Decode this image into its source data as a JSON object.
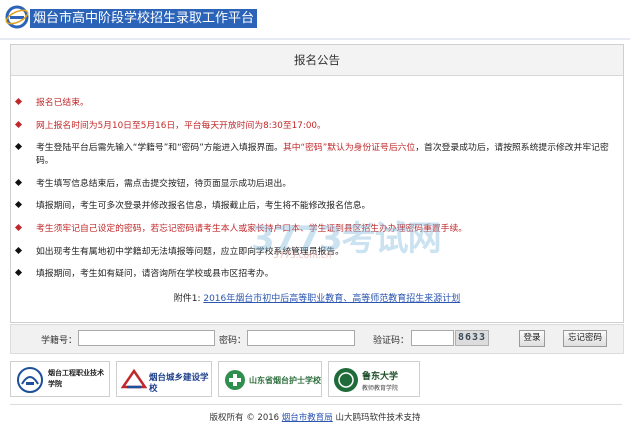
{
  "header": {
    "site_title": "烟台市高中阶段学校招生录取工作平台"
  },
  "panel": {
    "heading": "报名公告"
  },
  "notices": [
    {
      "color": "red",
      "text": "报名已结束。"
    },
    {
      "color": "red",
      "text": "网上报名时间为5月10日至5月16日，平台每天开放时间为8:30至17:00。"
    },
    {
      "color": "black",
      "text_a": "考生登陆平台后需先输入“学籍号”和“密码”方能进入填报界面。",
      "text_red": "其中“密码”默认为身份证号后六位",
      "text_b": "，首次登录成功后，请按照系统提示修改并牢记密码。"
    },
    {
      "color": "black",
      "text": "考生填写信息结束后，需点击提交按钮，待页面显示成功后退出。"
    },
    {
      "color": "black",
      "text": "填报期间，考生可多次登录并修改报名信息，填报截止后，考生将不能修改报名信息。"
    },
    {
      "color": "red",
      "text": "考生须牢记自己设定的密码，若忘记密码请考生本人或家长持户口本、学生证到县区招生办办理密码重置手续。"
    },
    {
      "color": "black",
      "text": "如出现考生有属地初中学籍却无法填报等问题，应立即向学校系统管理员报告。"
    },
    {
      "color": "black",
      "text": "填报期间，考生如有疑问，请咨询所在学校或县市区招考办。"
    }
  ],
  "attachment": {
    "prefix": "附件1: ",
    "link": "2016年烟台市初中后高等职业教育、高等师范教育招生来源计划"
  },
  "watermark": {
    "big": "3773考试网",
    "small": "3773.com.cn"
  },
  "login": {
    "student_id_label": "学籍号：",
    "password_label": "密码：",
    "captcha_label": "验证码：",
    "captcha_value": "8633",
    "login_button": "登录",
    "forgot_button": "忘记密码"
  },
  "logos": [
    {
      "name": "烟台工程职业技术学院"
    },
    {
      "name": "烟台城乡建设学校"
    },
    {
      "name": "山东省烟台护士学校"
    },
    {
      "name": "鲁东大学",
      "sub": "教师教育学院"
    }
  ],
  "footer": {
    "prefix": "版权所有 © 2016 ",
    "link": "烟台市教育局",
    "suffix": " 山大鸥玛软件技术支持"
  },
  "colors": {
    "title_bg": "#2a63b8",
    "notice_red": "#c0292b",
    "link_blue": "#2a55b0"
  }
}
